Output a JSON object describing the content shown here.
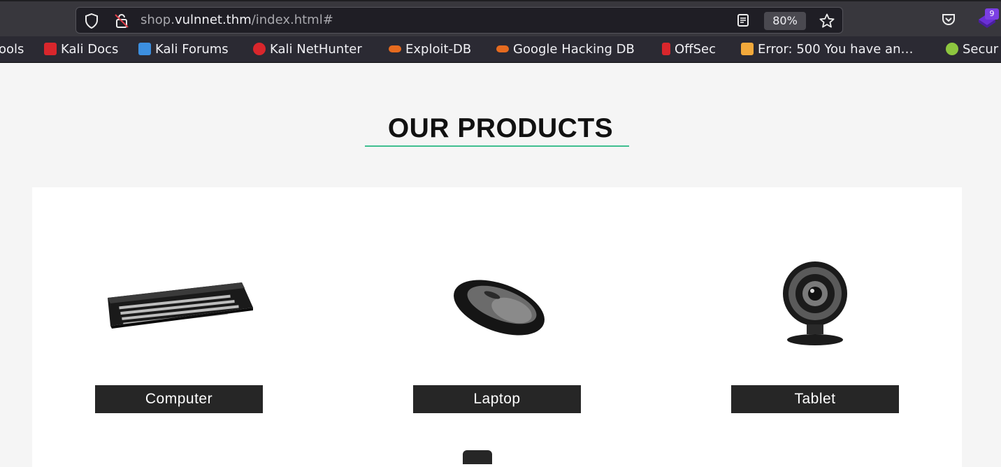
{
  "browser": {
    "url_prefix": "shop.",
    "url_domain": "vulnnet.thm",
    "url_path": "/index.html#",
    "zoom": "80%",
    "extension_badge": "9"
  },
  "bookmarks": [
    {
      "label": "ools",
      "icon": "truncated-item"
    },
    {
      "label": "Kali Docs",
      "icon": "kali-docs-icon"
    },
    {
      "label": "Kali Forums",
      "icon": "kali-forums-icon"
    },
    {
      "label": "Kali NetHunter",
      "icon": "kali-nethunter-icon"
    },
    {
      "label": "Exploit-DB",
      "icon": "exploit-db-icon"
    },
    {
      "label": "Google Hacking DB",
      "icon": "ghdb-icon"
    },
    {
      "label": "OffSec",
      "icon": "offsec-icon"
    },
    {
      "label": "Error: 500 You have an…",
      "icon": "joomla-icon"
    },
    {
      "label": "Secur",
      "icon": "security-icon"
    }
  ],
  "page": {
    "heading": "OUR PRODUCTS",
    "accent_color": "#3fbf8f",
    "products": [
      {
        "label": "Computer",
        "icon": "keyboard-icon"
      },
      {
        "label": "Laptop",
        "icon": "mouse-icon"
      },
      {
        "label": "Tablet",
        "icon": "webcam-icon"
      }
    ]
  }
}
